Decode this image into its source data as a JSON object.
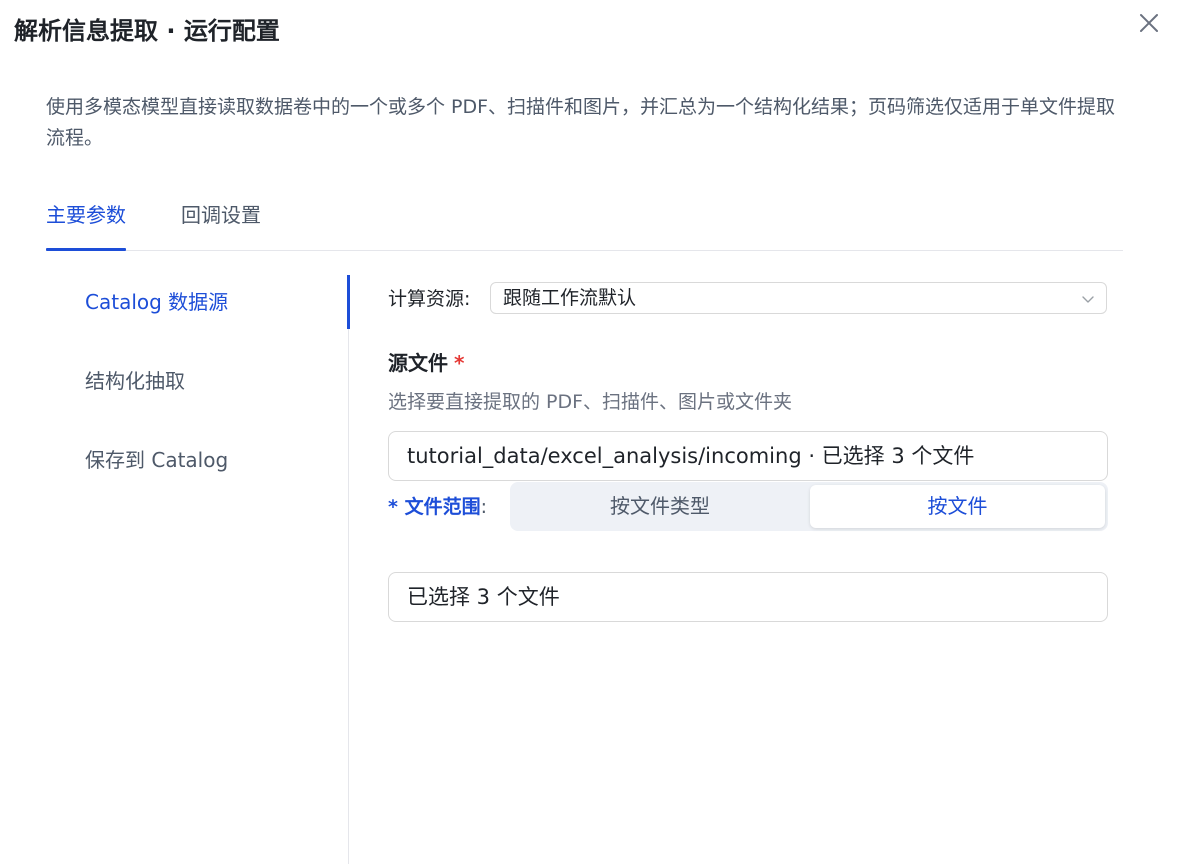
{
  "dialog": {
    "title": "解析信息提取 · 运行配置",
    "close_icon": "close-icon",
    "description": "使用多模态模型直接读取数据卷中的一个或多个 PDF、扫描件和图片，并汇总为一个结构化结果；页码筛选仅适用于单文件提取流程。"
  },
  "tabs": [
    {
      "label": "主要参数",
      "active": true
    },
    {
      "label": "回调设置",
      "active": false
    }
  ],
  "side_nav": {
    "items": [
      {
        "label": "Catalog 数据源",
        "active": true
      },
      {
        "label": "结构化抽取",
        "active": false
      },
      {
        "label": "保存到 Catalog",
        "active": false
      }
    ]
  },
  "form": {
    "compute": {
      "label": "计算资源:",
      "value": "跟随工作流默认",
      "icon": "chevron-down-icon"
    },
    "source": {
      "label": "源文件",
      "required_mark": "*",
      "help": "选择要直接提取的 PDF、扫描件、图片或文件夹",
      "value": "tutorial_data/excel_analysis/incoming · 已选择 3 个文件"
    },
    "scope": {
      "required_mark": "*",
      "label": "文件范围",
      "colon": ":",
      "options": [
        {
          "label": "按文件类型",
          "selected": false
        },
        {
          "label": "按文件",
          "selected": true
        }
      ]
    },
    "selected_files": {
      "value": "已选择 3 个文件"
    }
  },
  "colors": {
    "accent": "#1d4ed8",
    "required": "#e53935",
    "text": "#1f2329",
    "muted": "#4e5969",
    "border": "#d9d9d9",
    "segment_bg": "#eef1f6"
  }
}
